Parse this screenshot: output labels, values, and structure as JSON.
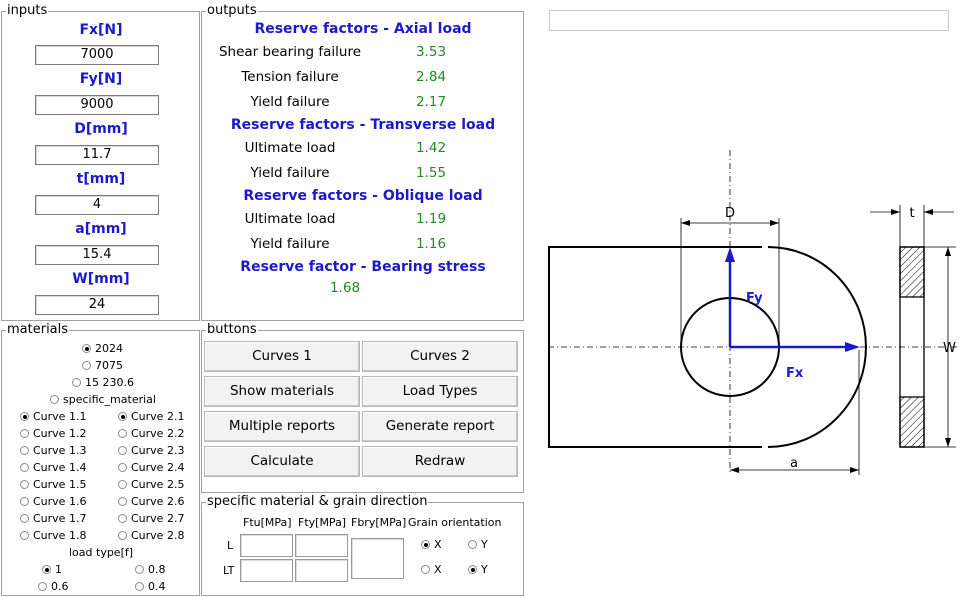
{
  "inputs": {
    "title": "inputs",
    "fields": [
      {
        "label": "Fx[N]",
        "value": "7000"
      },
      {
        "label": "Fy[N]",
        "value": "9000"
      },
      {
        "label": "D[mm]",
        "value": "11.7"
      },
      {
        "label": "t[mm]",
        "value": "4"
      },
      {
        "label": "a[mm]",
        "value": "15.4"
      },
      {
        "label": "W[mm]",
        "value": "24"
      }
    ]
  },
  "outputs": {
    "title": "outputs",
    "axial_title": "Reserve factors - Axial load",
    "axial": [
      {
        "label": "Shear bearing failure",
        "value": "3.53"
      },
      {
        "label": "Tension failure",
        "value": "2.84"
      },
      {
        "label": "Yield failure",
        "value": "2.17"
      }
    ],
    "transverse_title": "Reserve factors - Transverse load",
    "transverse": [
      {
        "label": "Ultimate load",
        "value": "1.42"
      },
      {
        "label": "Yield failure",
        "value": "1.55"
      }
    ],
    "oblique_title": "Reserve factors - Oblique load",
    "oblique": [
      {
        "label": "Ultimate load",
        "value": "1.19"
      },
      {
        "label": "Yield failure",
        "value": "1.16"
      }
    ],
    "bearing_title": "Reserve factor - Bearing stress",
    "bearing_value": "1.68"
  },
  "materials": {
    "title": "materials",
    "alloys": [
      "2024",
      "7075",
      "15 230.6",
      "specific_material"
    ],
    "selected_alloy": "2024",
    "curves_left": [
      "Curve 1.1",
      "Curve 1.2",
      "Curve 1.3",
      "Curve 1.4",
      "Curve 1.5",
      "Curve 1.6",
      "Curve 1.7",
      "Curve 1.8"
    ],
    "curves_right": [
      "Curve 2.1",
      "Curve 2.2",
      "Curve 2.3",
      "Curve 2.4",
      "Curve 2.5",
      "Curve 2.6",
      "Curve 2.7",
      "Curve 2.8"
    ],
    "selected_left": "Curve 1.1",
    "selected_right": "Curve 2.1",
    "load_type_label": "load type[f]",
    "load_types": [
      "1",
      "0.8",
      "0.6",
      "0.4"
    ],
    "selected_load_type": "1"
  },
  "buttons": {
    "title": "buttons",
    "curves1": "Curves 1",
    "curves2": "Curves 2",
    "show_materials": "Show materials",
    "load_types": "Load Types",
    "multiple_reports": "Multiple reports",
    "generate_report": "Generate report",
    "calculate": "Calculate",
    "redraw": "Redraw"
  },
  "specific_material": {
    "title": "specific material & grain direction",
    "col_ftu": "Ftu[MPa]",
    "col_fty": "Fty[MPa]",
    "col_fbry": "Fbry[MPa]",
    "col_grain": "Grain orientation",
    "row_l": "L",
    "row_lt": "LT",
    "grain_l_options": [
      "X",
      "Y"
    ],
    "grain_l_selected": "X",
    "grain_lt_options": [
      "X",
      "Y"
    ],
    "grain_lt_selected": "Y"
  },
  "top_field": {
    "value": ""
  },
  "drawing": {
    "label_D": "D",
    "label_t": "t",
    "label_W": "W",
    "label_a": "a",
    "label_Fx": "Fx",
    "label_Fy": "Fy",
    "force_color": "#1a1acc"
  }
}
